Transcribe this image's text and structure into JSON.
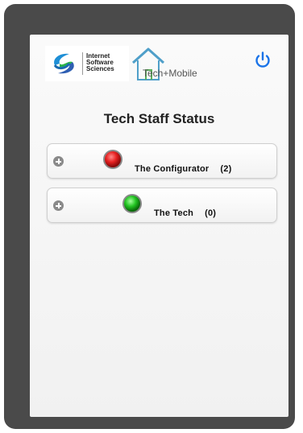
{
  "logo": {
    "line1": "Internet",
    "line2": "Software",
    "line3": "Sciences"
  },
  "app": {
    "name": "Tech+Mobile"
  },
  "page": {
    "title": "Tech Staff Status"
  },
  "staff": [
    {
      "name": "The  Configurator",
      "count": "(2)",
      "status_color": "#e62020"
    },
    {
      "name": "The  Tech",
      "count": "(0)",
      "status_color": "#22c422"
    }
  ],
  "colors": {
    "frame": "#4a4a4a",
    "power_icon": "#1a73e8",
    "house_icon": "#4f9fc9"
  },
  "icons": {
    "power": "power-icon",
    "expand": "plus-circle-icon",
    "status": "status-orb-icon",
    "house": "house-icon"
  }
}
